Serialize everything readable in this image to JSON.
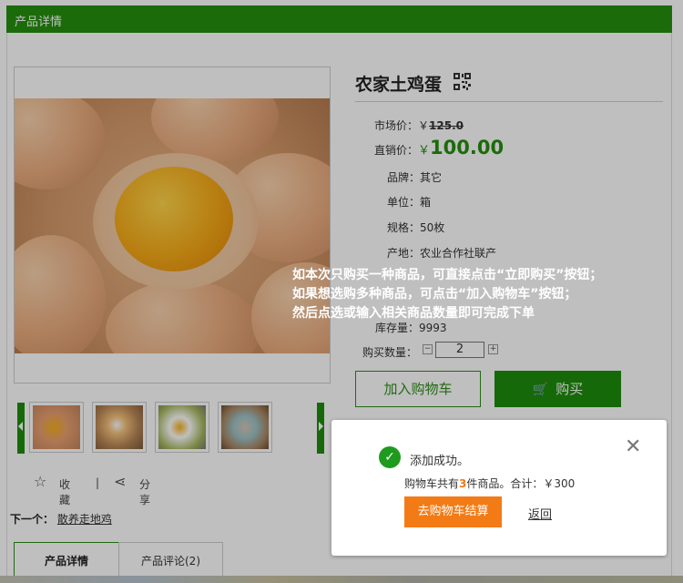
{
  "header": {
    "title": "产品详情"
  },
  "product": {
    "name": "农家土鸡蛋",
    "market_price_label": "市场价：",
    "market_price_currency": "￥",
    "market_price": "125.0",
    "direct_price_label": "直销价：",
    "direct_price_currency": "￥",
    "direct_price": "100.00",
    "attributes": [
      {
        "label": "品牌：",
        "value": "其它"
      },
      {
        "label": "单位：",
        "value": "箱"
      },
      {
        "label": "规格：",
        "value": "50枚"
      },
      {
        "label": "产地：",
        "value": "农业合作社联产"
      }
    ],
    "stock_label": "库存量：",
    "stock_value": "9993",
    "qty_label": "购买数量：",
    "qty_value": "2",
    "qty_minus": "−",
    "qty_plus": "+"
  },
  "buttons": {
    "add_to_cart": "加入购物车",
    "buy_now": "购买"
  },
  "social": {
    "favorite": "收藏",
    "separator": "|",
    "share": "分享"
  },
  "next_item": {
    "label": "下一个：",
    "link": "散养走地鸡"
  },
  "tabs": [
    {
      "label": "产品详情",
      "active": true
    },
    {
      "label": "产品评论(2)",
      "active": false
    }
  ],
  "hint": {
    "lines": [
      "如本次只购买一种商品，可直接点击“立即购买”按钮；",
      "如果想选购多种商品，可点击“加入购物车”按钮；",
      "然后点选或输入相关商品数量即可完成下单"
    ]
  },
  "dialog": {
    "message": "添加成功。",
    "summary_pre": "购物车共有",
    "summary_count": "3",
    "summary_mid": "件商品。合计：￥300",
    "checkout_label": "去购物车结算",
    "back_label": "返回",
    "close_icon": "close-icon",
    "success_icon": "check-circle-icon"
  },
  "colors": {
    "brand_green": "#248f0e",
    "checkout_orange": "#f37b16",
    "success_green": "#1e9b1e"
  }
}
